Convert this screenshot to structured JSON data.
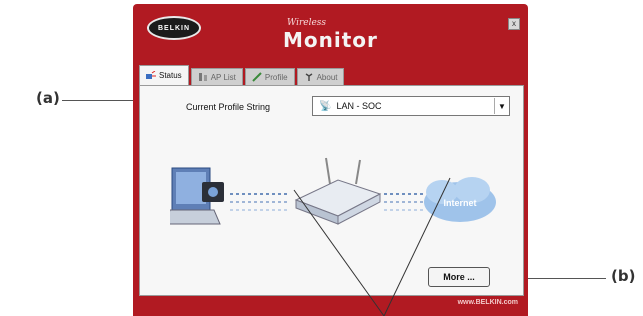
{
  "callouts": {
    "a": "(a)",
    "b": "(b)"
  },
  "window": {
    "logo_text": "BELKIN",
    "title_small": "Wireless",
    "title_big": "Monitor",
    "close_glyph": "x",
    "url": "www.BELKIN.com"
  },
  "tabs": [
    {
      "label": "Status",
      "icon": "status-icon",
      "active": true
    },
    {
      "label": "AP List",
      "icon": "ap-list-icon",
      "active": false
    },
    {
      "label": "Profile",
      "icon": "profile-icon",
      "active": false
    },
    {
      "label": "About",
      "icon": "about-icon",
      "active": false
    }
  ],
  "status": {
    "profile_label": "Current Profile String",
    "profile_value": "LAN - SOC",
    "internet_label": "Internet",
    "more_button": "More ..."
  },
  "colors": {
    "frame": "#b11a22",
    "panel": "#f7f7f7",
    "cloud": "#9fc3ea"
  }
}
